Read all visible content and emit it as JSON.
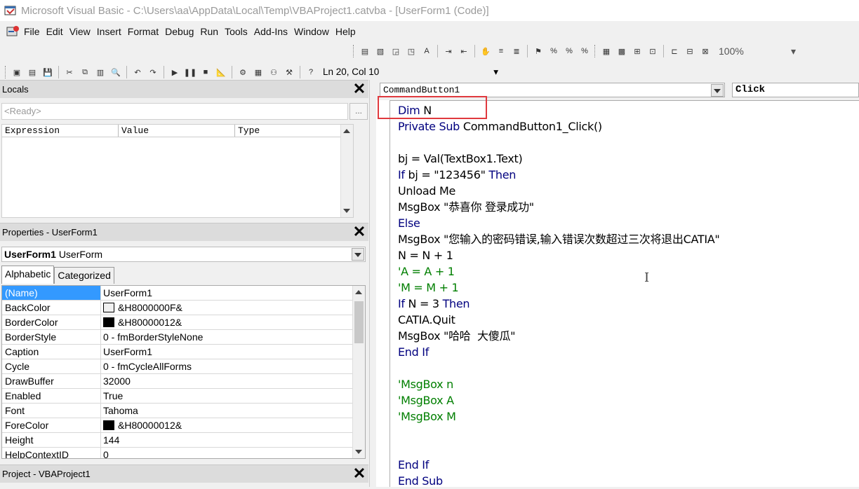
{
  "window": {
    "title": "Microsoft Visual Basic - C:\\Users\\aa\\AppData\\Local\\Temp\\VBAProject1.catvba - [UserForm1 (Code)]"
  },
  "menu": [
    "File",
    "Edit",
    "View",
    "Insert",
    "Format",
    "Debug",
    "Run",
    "Tools",
    "Add-Ins",
    "Window",
    "Help"
  ],
  "toolbar": {
    "zoom": "100%",
    "cursor_position": "Ln 20, Col 10"
  },
  "locals": {
    "title": "Locals",
    "status": "<Ready>",
    "dots_label": "...",
    "columns": [
      "Expression",
      "Value",
      "Type"
    ]
  },
  "properties": {
    "title": "Properties - UserForm1",
    "object_name": "UserForm1",
    "object_type": "UserForm",
    "tabs": [
      "Alphabetic",
      "Categorized"
    ],
    "rows": [
      {
        "name": "(Name)",
        "value": "UserForm1",
        "swatch": null
      },
      {
        "name": "BackColor",
        "value": "&H8000000F&",
        "swatch": "#f0f0f0"
      },
      {
        "name": "BorderColor",
        "value": "&H80000012&",
        "swatch": "#000000"
      },
      {
        "name": "BorderStyle",
        "value": "0 - fmBorderStyleNone",
        "swatch": null
      },
      {
        "name": "Caption",
        "value": "UserForm1",
        "swatch": null
      },
      {
        "name": "Cycle",
        "value": "0 - fmCycleAllForms",
        "swatch": null
      },
      {
        "name": "DrawBuffer",
        "value": "32000",
        "swatch": null
      },
      {
        "name": "Enabled",
        "value": "True",
        "swatch": null
      },
      {
        "name": "Font",
        "value": "Tahoma",
        "swatch": null
      },
      {
        "name": "ForeColor",
        "value": "&H80000012&",
        "swatch": "#000000"
      },
      {
        "name": "Height",
        "value": "144",
        "swatch": null
      },
      {
        "name": "HelpContextID",
        "value": "0",
        "swatch": null
      }
    ]
  },
  "project": {
    "title": "Project - VBAProject1"
  },
  "code": {
    "object_combo": "CommandButton1",
    "procedure_combo": "Click",
    "lines": [
      {
        "t": "Dim N",
        "kind": "kw-dim"
      },
      {
        "t": "Private Sub CommandButton1_Click()",
        "kind": "kw-sub"
      },
      {
        "t": "",
        "kind": "plain"
      },
      {
        "t": "bj = Val(TextBox1.Text)",
        "kind": "plain"
      },
      {
        "t": "If bj = \"123456\" Then",
        "kind": "kw-if"
      },
      {
        "t": "Unload Me",
        "kind": "plain"
      },
      {
        "t": "MsgBox \"恭喜你 登录成功\"",
        "kind": "plain"
      },
      {
        "t": "Else",
        "kind": "kw"
      },
      {
        "t": "MsgBox \"您输入的密码错误,输入错误次数超过三次将退出CATIA\"",
        "kind": "plain"
      },
      {
        "t": "N = N + 1",
        "kind": "plain"
      },
      {
        "t": "'A = A + 1",
        "kind": "cmt"
      },
      {
        "t": "'M = M + 1",
        "kind": "cmt"
      },
      {
        "t": "If N = 3 Then",
        "kind": "kw-if"
      },
      {
        "t": "CATIA.Quit",
        "kind": "plain"
      },
      {
        "t": "MsgBox \"哈哈  大傻瓜\"",
        "kind": "plain"
      },
      {
        "t": "End If",
        "kind": "kw"
      },
      {
        "t": "",
        "kind": "plain"
      },
      {
        "t": "'MsgBox n",
        "kind": "cmt"
      },
      {
        "t": "'MsgBox A",
        "kind": "cmt"
      },
      {
        "t": "'MsgBox M",
        "kind": "cmt"
      },
      {
        "t": "",
        "kind": "plain"
      },
      {
        "t": "",
        "kind": "plain"
      },
      {
        "t": "End If",
        "kind": "kw"
      },
      {
        "t": "End Sub",
        "kind": "kw"
      }
    ]
  },
  "colors": {
    "keyword": "#00007f",
    "comment": "#007f00",
    "highlight_box": "#e0393e",
    "selection": "#3399ff"
  }
}
